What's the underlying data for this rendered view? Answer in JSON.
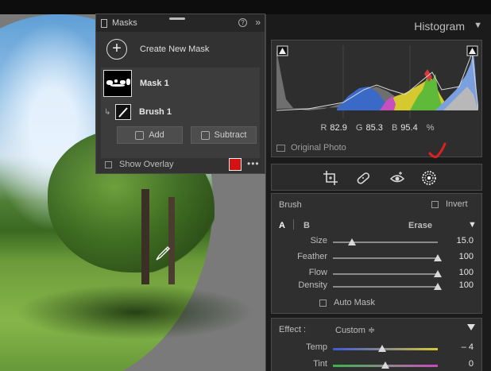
{
  "masks_panel": {
    "title": "Masks",
    "help_glyph": "?",
    "expand_glyph": "»",
    "create_label": "Create New Mask",
    "plus_glyph": "+",
    "mask_items": [
      {
        "label": "Mask 1",
        "icon": "mask-thumbnail"
      },
      {
        "label": "Brush 1",
        "icon": "brush-thumbnail"
      }
    ],
    "add_label": "Add",
    "subtract_label": "Subtract",
    "overlay_label": "Show Overlay",
    "overlay_color": "#d51212",
    "more_glyph": "•••"
  },
  "histogram": {
    "title": "Histogram",
    "caret": "▼",
    "r_label": "R",
    "r_value": "82.9",
    "g_label": "G",
    "g_value": "85.3",
    "b_label": "B",
    "b_value": "95.4",
    "unit": "%",
    "original_label": "Original Photo"
  },
  "tools": {
    "items": [
      "crop-icon",
      "healing-icon",
      "red-eye-icon",
      "masking-icon"
    ],
    "annotation_color": "#e02020"
  },
  "brush": {
    "title": "Brush",
    "invert_label": "Invert",
    "tabs": [
      "A",
      "B",
      "Erase"
    ],
    "caret": "▼",
    "sliders": [
      {
        "label": "Size",
        "value": "15.0",
        "position": 0.18
      },
      {
        "label": "Feather",
        "value": "100",
        "position": 1.0
      },
      {
        "label": "Flow",
        "value": "100",
        "position": 1.0
      },
      {
        "label": "Density",
        "value": "100",
        "position": 1.0
      }
    ],
    "auto_mask_label": "Auto Mask"
  },
  "effect": {
    "label": "Effect :",
    "value": "Custom ≑",
    "sliders": [
      {
        "label": "Temp",
        "value": "– 4",
        "position": 0.47
      },
      {
        "label": "Tint",
        "value": "0",
        "position": 0.5
      }
    ]
  }
}
